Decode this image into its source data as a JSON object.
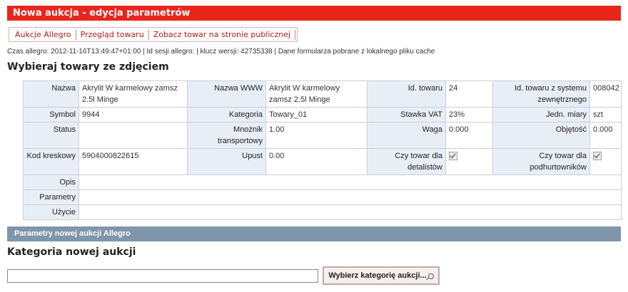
{
  "window": {
    "title": "Nowa aukcja - edycja parametrów"
  },
  "tabs": [
    {
      "label": "Aukcje Allegro"
    },
    {
      "label": "Przegląd towaru"
    },
    {
      "label": "Zobacz towar na stronie publicznej"
    }
  ],
  "infoline": "Czas allegro: 2012-11-16T13:49:47+01:00 | Id sesji allegro: | klucz wersji: 42735338 | Dane formularza pobrane z lokalnego pliku cache",
  "product_heading": "Wybieraj towary ze zdjęciem",
  "props": {
    "nazwa_label": "Nazwa",
    "nazwa_value": "Akrylit W karmelowy zamsz 2.5l Minge",
    "nazwa_www_label": "Nazwa WWW",
    "nazwa_www_value": "Akrylit W karmelowy zamsz 2.5l Minge",
    "id_towaru_label": "Id. towaru",
    "id_towaru_value": "24",
    "id_ext_label": "Id. towaru z systemu zewnętrznego",
    "id_ext_value": "008042",
    "symbol_label": "Symbol",
    "symbol_value": "9944",
    "kategoria_label": "Kategoria",
    "kategoria_value": "Towary_01",
    "vat_label": "Stawka VAT",
    "vat_value": "23%",
    "jm_label": "Jedn. miary",
    "jm_value": "szt",
    "status_label": "Status",
    "status_value": "",
    "mnoznik_label": "Mnożnik transportowy",
    "mnoznik_value": "1.00",
    "waga_label": "Waga",
    "waga_value": "0.000",
    "objetosc_label": "Objętość",
    "objetosc_value": "0.000",
    "kod_label": "Kod kreskowy",
    "kod_value": "5904000822615",
    "upust_label": "Upust",
    "upust_value": "0.00",
    "detal_label": "Czy towar dla detalistów",
    "detal_checked": true,
    "podhurt_label": "Czy towar dla podhurtowników",
    "podhurt_checked": true,
    "opis_label": "Opis",
    "opis_value": "",
    "parametry_label": "Parametry",
    "parametry_value": "",
    "uzycie_label": "Użycie",
    "uzycie_value": ""
  },
  "section_title": "Parametry nowej aukcji Allegro",
  "category_heading": "Kategoria nowej aukcji",
  "category_input": {
    "value": "",
    "placeholder": ""
  },
  "category_button": "Wybierz kategorię aukcji..."
}
